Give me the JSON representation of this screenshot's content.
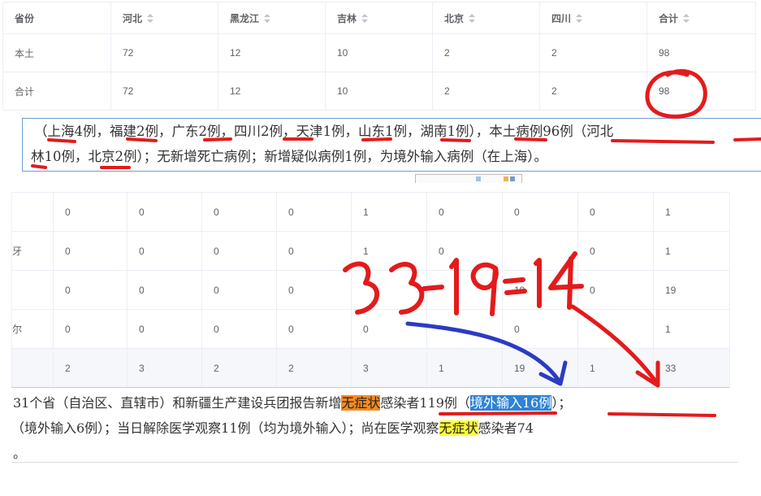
{
  "top_table": {
    "headers": [
      "省份",
      "河北",
      "黑龙江",
      "吉林",
      "北京",
      "四川",
      "合计"
    ],
    "rows": [
      [
        "本土",
        "72",
        "12",
        "10",
        "2",
        "2",
        "98"
      ],
      [
        "合计",
        "72",
        "12",
        "10",
        "2",
        "2",
        "98"
      ]
    ]
  },
  "para1": {
    "line1": {
      "a": "（",
      "shanghai": "上海4例",
      "b": "，",
      "fujian": "福建2例",
      "c": "，",
      "guangdong": "广东2例",
      "d": "，",
      "sichuan": "四川2例",
      "e": "，",
      "tianjin": "天津1例",
      "f": "，",
      "shandong": "山东1例",
      "g": "，",
      "hunan": "湖南1例",
      "h": "），",
      "local": "本土病例96例",
      "i": "（",
      "hebei": "河北"
    },
    "line2": {
      "jilin": "林10例",
      "a": "，",
      "beijing": "北京2例",
      "b": "）；无新增死亡病例；新增疑似病例1例，为境外输入病例（在上海）。"
    }
  },
  "bottom_table": {
    "rows": [
      {
        "label": "",
        "values": [
          "0",
          "0",
          "0",
          "0",
          "1",
          "0",
          "0",
          "0",
          "1"
        ]
      },
      {
        "label": "牙",
        "values": [
          "0",
          "0",
          "0",
          "0",
          "1",
          "0",
          "",
          "0",
          "1"
        ]
      },
      {
        "label": "",
        "values": [
          "0",
          "0",
          "0",
          "0",
          "",
          "",
          "19",
          "0",
          "19"
        ]
      },
      {
        "label": "尔",
        "values": [
          "0",
          "0",
          "0",
          "0",
          "0",
          "",
          "0",
          "",
          "1"
        ]
      },
      {
        "label": "",
        "values": [
          "2",
          "3",
          "2",
          "2",
          "3",
          "1",
          "19",
          "1",
          "33"
        ]
      }
    ]
  },
  "annotation": {
    "equation": "33-19=14",
    "pen_color_red": "#e31b1b",
    "pen_color_blue": "#2b3bc4"
  },
  "para2": {
    "line1": {
      "a": "31个省（自治区、直辖市）和新疆生产建设兵团报告新增",
      "asym": "无症状",
      "b": "感染者119例（",
      "imported": "境外输入16例",
      "c": "）；"
    },
    "line2": {
      "a": "（境外输入6例）；当日解除医学观察11例（均为境外输入）；尚在医学观察",
      "asym": "无症状",
      "b": "感染者74"
    },
    "line3": "。"
  }
}
